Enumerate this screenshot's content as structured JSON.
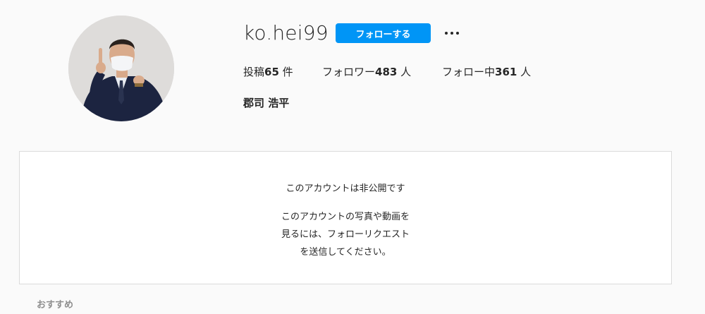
{
  "profile": {
    "username": "ko.hei99",
    "full_name": "郡司 浩平",
    "follow_label": "フォローする",
    "more_icon": "more-options-icon",
    "stats": {
      "posts_label": "投稿",
      "posts_count": "65",
      "posts_unit": " 件",
      "followers_label": "フォロワー",
      "followers_count": "483",
      "followers_unit": " 人",
      "following_label": "フォロー中",
      "following_count": "361",
      "following_unit": " 人"
    }
  },
  "private_notice": {
    "title": "このアカウントは非公開です",
    "description": "このアカウントの写真や動画を見るには、フォローリクエストを送信してください。"
  },
  "suggestions": {
    "label": "おすすめ"
  },
  "colors": {
    "accent": "#0095f6",
    "background": "#fafafa",
    "border": "#dbdbdb",
    "muted": "#8e8e8e"
  }
}
